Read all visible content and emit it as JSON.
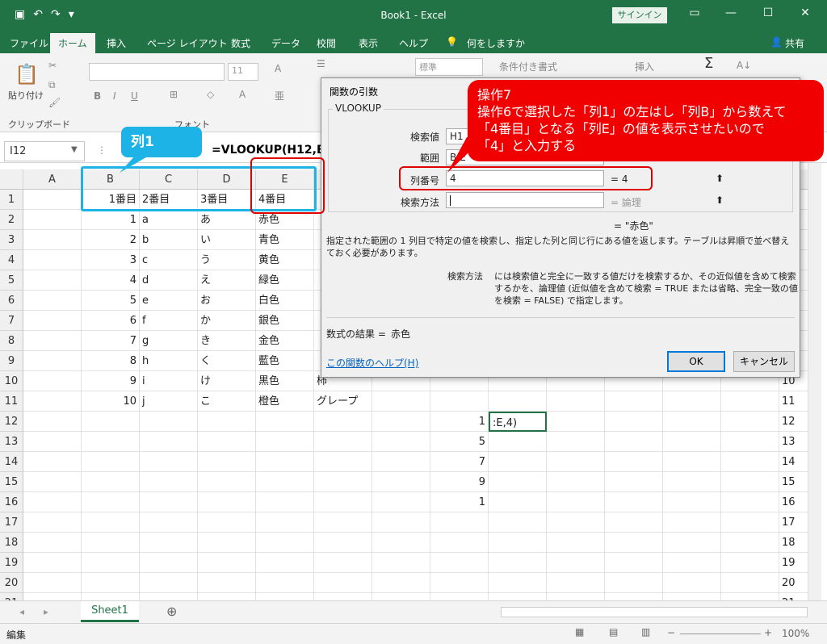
{
  "app": {
    "title": "Book1 - Excel",
    "signin": "サインイン",
    "share": "共有"
  },
  "tabs": [
    "ファイル",
    "ホーム",
    "挿入",
    "ページ レイアウト",
    "数式",
    "データ",
    "校閲",
    "表示",
    "ヘルプ",
    "何をしますか"
  ],
  "ribbon": {
    "paste": "貼り付け",
    "clipboard": "クリップボード",
    "font_group": "フォント",
    "font_size": "11",
    "number_format": "標準",
    "conditional": "条件付き書式",
    "insert": "挿入"
  },
  "formula_bar": {
    "name_box": "I12",
    "fx": "fx",
    "formula": "=VLOOKUP(H12,B"
  },
  "columns": [
    "A",
    "B",
    "C",
    "D",
    "E"
  ],
  "rows": [
    {
      "n": "1",
      "a": "",
      "b": "1番目",
      "c": "2番目",
      "d": "3番目",
      "e": "4番目",
      "f": "",
      "h": "",
      "i": ""
    },
    {
      "n": "2",
      "a": "",
      "b": "1",
      "c": "a",
      "d": "あ",
      "e": "赤色",
      "f": "",
      "h": "",
      "i": ""
    },
    {
      "n": "3",
      "a": "",
      "b": "2",
      "c": "b",
      "d": "い",
      "e": "青色",
      "f": "",
      "h": "",
      "i": ""
    },
    {
      "n": "4",
      "a": "",
      "b": "3",
      "c": "c",
      "d": "う",
      "e": "黄色",
      "f": "",
      "h": "",
      "i": ""
    },
    {
      "n": "5",
      "a": "",
      "b": "4",
      "c": "d",
      "d": "え",
      "e": "緑色",
      "f": "",
      "h": "",
      "i": ""
    },
    {
      "n": "6",
      "a": "",
      "b": "5",
      "c": "e",
      "d": "お",
      "e": "白色",
      "f": "",
      "h": "",
      "i": ""
    },
    {
      "n": "7",
      "a": "",
      "b": "6",
      "c": "f",
      "d": "か",
      "e": "銀色",
      "f": "",
      "h": "",
      "i": ""
    },
    {
      "n": "8",
      "a": "",
      "b": "7",
      "c": "g",
      "d": "き",
      "e": "金色",
      "f": "",
      "h": "",
      "i": ""
    },
    {
      "n": "9",
      "a": "",
      "b": "8",
      "c": "h",
      "d": "く",
      "e": "藍色",
      "f": "",
      "h": "",
      "i": ""
    },
    {
      "n": "10",
      "a": "",
      "b": "9",
      "c": "i",
      "d": "け",
      "e": "黒色",
      "f": "柿",
      "h": "",
      "i": ""
    },
    {
      "n": "11",
      "a": "",
      "b": "10",
      "c": "j",
      "d": "こ",
      "e": "橙色",
      "f": "グレープ",
      "h": "",
      "i": ""
    },
    {
      "n": "12",
      "a": "",
      "b": "",
      "c": "",
      "d": "",
      "e": "",
      "f": "",
      "h": "1",
      "i": ":E,4)"
    },
    {
      "n": "13",
      "a": "",
      "b": "",
      "c": "",
      "d": "",
      "e": "",
      "f": "",
      "h": "5",
      "i": ""
    },
    {
      "n": "14",
      "a": "",
      "b": "",
      "c": "",
      "d": "",
      "e": "",
      "f": "",
      "h": "7",
      "i": ""
    },
    {
      "n": "15",
      "a": "",
      "b": "",
      "c": "",
      "d": "",
      "e": "",
      "f": "",
      "h": "9",
      "i": ""
    },
    {
      "n": "16",
      "a": "",
      "b": "",
      "c": "",
      "d": "",
      "e": "",
      "f": "",
      "h": "1",
      "i": ""
    },
    {
      "n": "17",
      "a": "",
      "b": "",
      "c": "",
      "d": "",
      "e": "",
      "f": "",
      "h": "",
      "i": ""
    },
    {
      "n": "18",
      "a": "",
      "b": "",
      "c": "",
      "d": "",
      "e": "",
      "f": "",
      "h": "",
      "i": ""
    },
    {
      "n": "19",
      "a": "",
      "b": "",
      "c": "",
      "d": "",
      "e": "",
      "f": "",
      "h": "",
      "i": ""
    },
    {
      "n": "20",
      "a": "",
      "b": "",
      "c": "",
      "d": "",
      "e": "",
      "f": "",
      "h": "",
      "i": ""
    },
    {
      "n": "21",
      "a": "",
      "b": "",
      "c": "",
      "d": "",
      "e": "",
      "f": "",
      "h": "",
      "i": ""
    }
  ],
  "sheet": {
    "tab": "Sheet1",
    "add": "⊕"
  },
  "status": {
    "mode": "編集",
    "zoom": "100%"
  },
  "dialog": {
    "title": "関数の引数",
    "function": "VLOOKUP",
    "args": [
      {
        "label": "検索値",
        "value": "H1",
        "result": ""
      },
      {
        "label": "範囲",
        "value": "B:E",
        "result": ""
      },
      {
        "label": "列番号",
        "value": "4",
        "result": "=  4"
      },
      {
        "label": "検索方法",
        "value": "",
        "result": "=  論理"
      }
    ],
    "overall_result": "=  \"赤色\"",
    "description": "指定された範囲の 1 列目で特定の値を検索し、指定した列と同じ行にある値を返します。テーブルは昇順で並べ替えておく必要があります。",
    "arg_name": "検索方法",
    "arg_help": "には検索値と完全に一致する値だけを検索するか、その近似値を含めて検索するかを、論理値 (近似値を含めて検索 = TRUE または省略、完全一致の値を検索 = FALSE) で指定します。",
    "result_label": "数式の結果 =",
    "result_value": "赤色",
    "help_link": "この関数のヘルプ(H)",
    "ok": "OK",
    "cancel": "キャンセル"
  },
  "annotations": {
    "red_callout": [
      "操作7",
      "操作6で選択した「列1」の左はし「列B」から数えて",
      "「4番目」となる「列E」の値を表示させたいので",
      "「4」と入力する"
    ],
    "blue_callout": "列1"
  },
  "colors": {
    "excel_green": "#217346",
    "callout_red": "#f00000",
    "callout_blue": "#1eb3e6"
  }
}
